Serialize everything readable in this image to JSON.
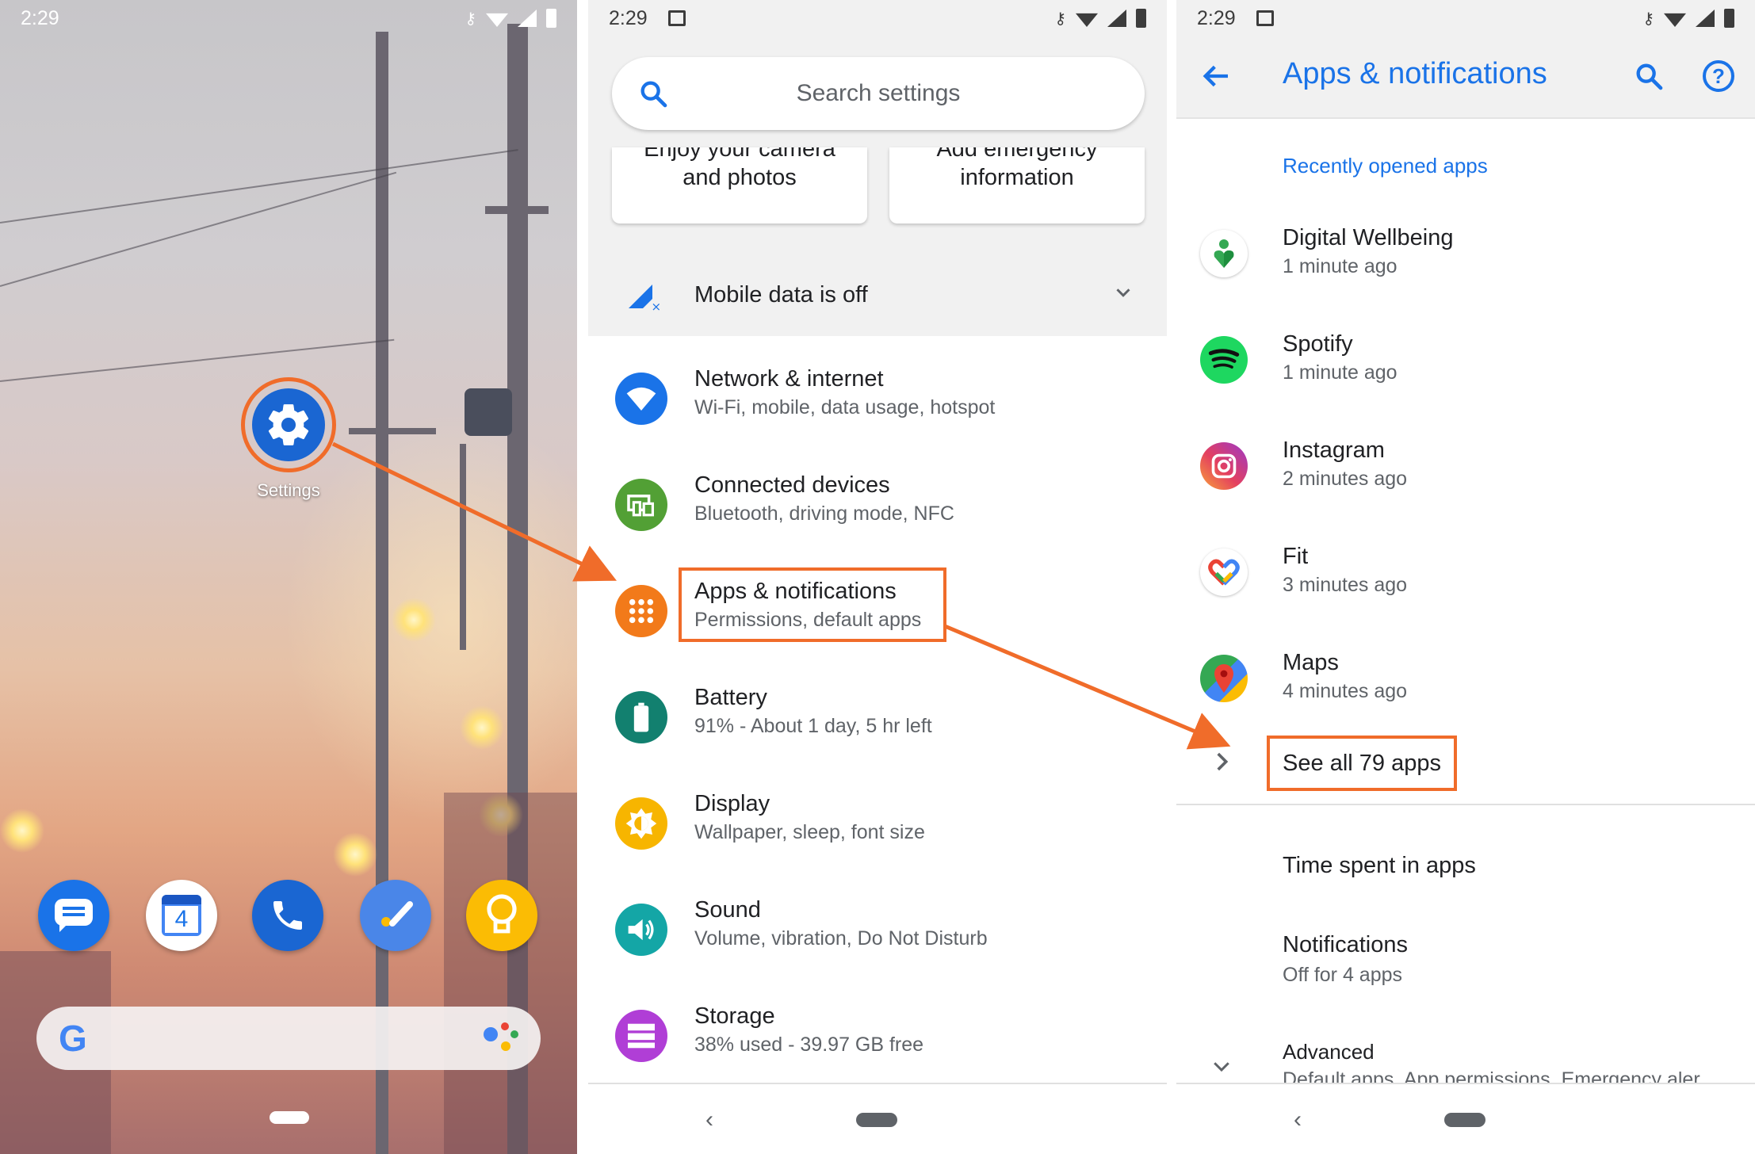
{
  "home": {
    "time": "2:29",
    "settings_label": "Settings",
    "calendar_day": "4",
    "dock_icons": [
      "messages-icon",
      "calendar-icon",
      "phone-icon",
      "tasks-icon",
      "keep-icon"
    ],
    "search_logo": "G"
  },
  "settings": {
    "time": "2:29",
    "search_placeholder": "Search settings",
    "suggestions": [
      {
        "line1": "Enjoy your camera",
        "line2": "and photos"
      },
      {
        "line1": "Add emergency",
        "line2": "information"
      }
    ],
    "mobile_data": "Mobile data is off",
    "items": [
      {
        "title": "Network & internet",
        "subtitle": "Wi-Fi, mobile, data usage, hotspot",
        "icon": "wifi-icon",
        "color": "#1a73e8"
      },
      {
        "title": "Connected devices",
        "subtitle": "Bluetooth, driving mode, NFC",
        "icon": "devices-icon",
        "color": "#52a035"
      },
      {
        "title": "Apps & notifications",
        "subtitle": "Permissions, default apps",
        "icon": "apps-grid-icon",
        "color": "#f27a1a"
      },
      {
        "title": "Battery",
        "subtitle": "91% - About 1 day, 5 hr left",
        "icon": "battery-icon",
        "color": "#12806f"
      },
      {
        "title": "Display",
        "subtitle": "Wallpaper, sleep, font size",
        "icon": "brightness-icon",
        "color": "#f7b500"
      },
      {
        "title": "Sound",
        "subtitle": "Volume, vibration, Do Not Disturb",
        "icon": "volume-icon",
        "color": "#14a6a6"
      },
      {
        "title": "Storage",
        "subtitle": "38% used - 39.97 GB free",
        "icon": "storage-icon",
        "color": "#b03ed6"
      }
    ]
  },
  "apps": {
    "time": "2:29",
    "title": "Apps & notifications",
    "recent_header": "Recently opened apps",
    "recent": [
      {
        "name": "Digital Wellbeing",
        "time": "1 minute ago",
        "icon": "digital-wellbeing-icon"
      },
      {
        "name": "Spotify",
        "time": "1 minute ago",
        "icon": "spotify-icon"
      },
      {
        "name": "Instagram",
        "time": "2 minutes ago",
        "icon": "instagram-icon"
      },
      {
        "name": "Fit",
        "time": "3 minutes ago",
        "icon": "fit-icon"
      },
      {
        "name": "Maps",
        "time": "4 minutes ago",
        "icon": "maps-icon"
      }
    ],
    "see_all": "See all 79 apps",
    "time_spent": "Time spent in apps",
    "notifications": "Notifications",
    "notifications_sub": "Off for 4 apps",
    "advanced": "Advanced",
    "advanced_sub": "Default apps, App permissions, Emergency aler"
  },
  "colors": {
    "accent": "#1a73e8",
    "highlight": "#f06c2a"
  }
}
